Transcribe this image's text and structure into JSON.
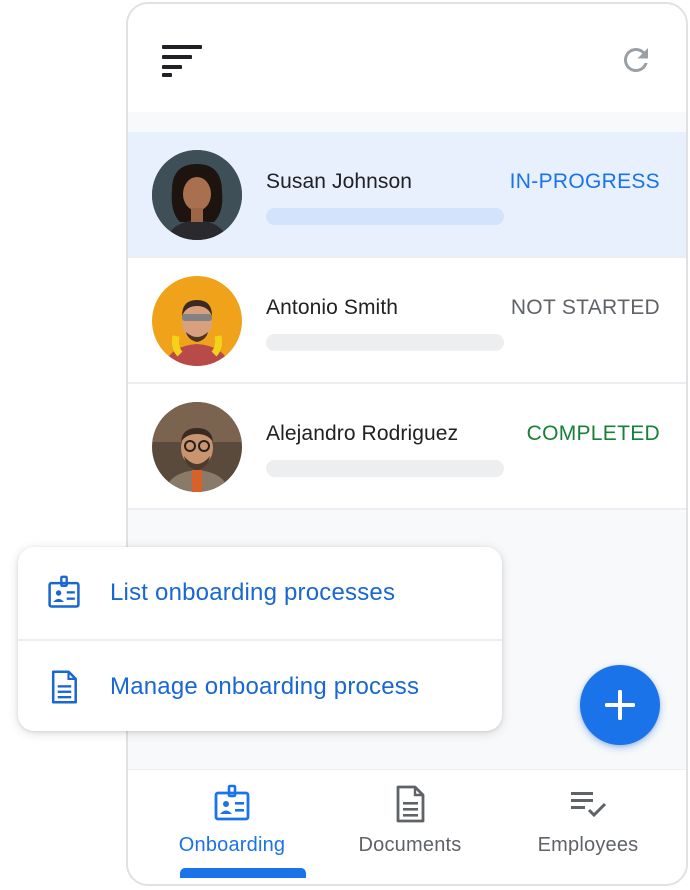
{
  "colors": {
    "accent": "#1a73e8",
    "in_progress": "#1a73e8",
    "not_started": "#5f6368",
    "completed": "#188038",
    "selected_row": "#e8f0fe"
  },
  "header": {
    "menu_icon": "sort-icon",
    "refresh_icon": "refresh-icon"
  },
  "employees": [
    {
      "name": "Susan Johnson",
      "status": "IN-PROGRESS"
    },
    {
      "name": "Antonio Smith",
      "status": "NOT STARTED"
    },
    {
      "name": "Alejandro Rodriguez",
      "status": "COMPLETED"
    }
  ],
  "popup_menu": {
    "items": [
      {
        "label": "List onboarding processes",
        "icon": "badge-icon"
      },
      {
        "label": "Manage onboarding process",
        "icon": "document-icon"
      }
    ]
  },
  "fab": {
    "icon": "plus-icon"
  },
  "bottom_nav": {
    "items": [
      {
        "label": "Onboarding",
        "icon": "badge-icon"
      },
      {
        "label": "Documents",
        "icon": "document-icon"
      },
      {
        "label": "Employees",
        "icon": "checklist-icon"
      }
    ],
    "active": "Onboarding"
  }
}
